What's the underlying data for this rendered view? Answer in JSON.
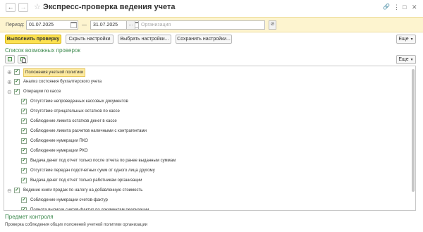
{
  "window": {
    "title": "Экспресс-проверка ведения учета",
    "back_icon": "←",
    "forward_icon": "→",
    "star_icon": "☆",
    "link_icon": "🔗",
    "more_icon": "⋮",
    "maximize_icon": "□",
    "close_icon": "✕"
  },
  "filters": {
    "period_label": "Период:",
    "date_from": "01.07.2025",
    "dash": "—",
    "date_to": "31.07.2025",
    "choose_period_label": "...",
    "organization_placeholder": "Организация",
    "clear_icon": "⊘"
  },
  "toolbar": {
    "run_check_label": "Выполнить проверку",
    "hide_settings_label": "Скрыть настройки",
    "choose_settings_label": "Выбрать настройки...",
    "save_settings_label": "Сохранить настройки...",
    "more_label": "Еще"
  },
  "checks": {
    "title": "Список возможных проверок",
    "more_label": "Еще",
    "items": [
      {
        "label": "Положения учетной политики",
        "level": 0,
        "checked": true,
        "expandable": true,
        "selected": true
      },
      {
        "label": "Анализ состояния бухгалтерского учета",
        "level": 0,
        "checked": true,
        "expandable": true
      },
      {
        "label": "Операции по кассе",
        "level": 0,
        "checked": true,
        "expandable": true,
        "expanded": true
      },
      {
        "label": "Отсутствие непроведенных кассовых документов",
        "level": 1,
        "checked": true
      },
      {
        "label": "Отсутствие отрицательных остатков по кассе",
        "level": 1,
        "checked": true
      },
      {
        "label": "Соблюдение лимита остатков денег в кассе",
        "level": 1,
        "checked": true
      },
      {
        "label": "Соблюдение лимита расчетов наличными с контрагентами",
        "level": 1,
        "checked": true
      },
      {
        "label": "Соблюдение нумерации ПКО",
        "level": 1,
        "checked": true
      },
      {
        "label": "Соблюдение нумерации РКО",
        "level": 1,
        "checked": true
      },
      {
        "label": "Выдача денег под отчет только после отчета по ранее выданным суммам",
        "level": 1,
        "checked": true
      },
      {
        "label": "Отсутствие передач подотчетных сумм от одного лица другому",
        "level": 1,
        "checked": true
      },
      {
        "label": "Выдача денег под отчет только работникам организации",
        "level": 1,
        "checked": true
      },
      {
        "label": "Ведение книги продаж по налогу на добавленную стоимость",
        "level": 0,
        "checked": true,
        "expandable": true,
        "expanded": true
      },
      {
        "label": "Соблюдение нумерации счетов-фактур",
        "level": 1,
        "checked": true
      },
      {
        "label": "Полнота выписки счетов-фактур по документам реализации",
        "level": 1,
        "checked": true
      }
    ]
  },
  "subject": {
    "title": "Предмет контроля",
    "text": "Проверка соблюдения общих положений учетной политики организации"
  }
}
